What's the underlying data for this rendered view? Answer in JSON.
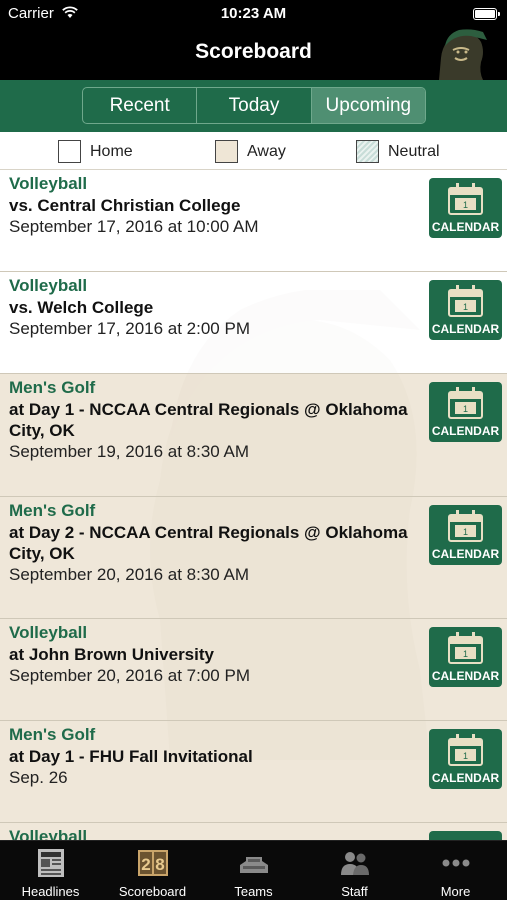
{
  "status_bar": {
    "carrier": "Carrier",
    "time": "10:23 AM"
  },
  "nav": {
    "title": "Scoreboard"
  },
  "segments": [
    {
      "label": "Recent",
      "active": false
    },
    {
      "label": "Today",
      "active": false
    },
    {
      "label": "Upcoming",
      "active": true
    }
  ],
  "legend": {
    "home": "Home",
    "away": "Away",
    "neutral": "Neutral"
  },
  "calendar_label": "CALENDAR",
  "calendar_day": "1",
  "events": [
    {
      "sport": "Volleyball",
      "opponent": "vs. Central Christian College",
      "date": "September 17, 2016 at 10:00 AM",
      "location": "home"
    },
    {
      "sport": "Volleyball",
      "opponent": "vs. Welch College",
      "date": "September 17, 2016 at 2:00 PM",
      "location": "home"
    },
    {
      "sport": "Men's Golf",
      "opponent": "at Day 1 - NCCAA Central Regionals @ Oklahoma City, OK",
      "date": "September 19, 2016 at 8:30 AM",
      "location": "away"
    },
    {
      "sport": "Men's Golf",
      "opponent": "at Day 2 - NCCAA Central Regionals @ Oklahoma City, OK",
      "date": "September 20, 2016 at 8:30 AM",
      "location": "away"
    },
    {
      "sport": "Volleyball",
      "opponent": "at John Brown University",
      "date": "September 20, 2016 at 7:00 PM",
      "location": "away"
    },
    {
      "sport": "Men's Golf",
      "opponent": "at Day 1 - FHU Fall Invitational",
      "date": "Sep. 26",
      "location": "away"
    },
    {
      "sport": "Volleyball",
      "opponent": "",
      "date": "",
      "location": "away"
    }
  ],
  "tabs": [
    {
      "label": "Headlines",
      "icon": "newspaper-icon"
    },
    {
      "label": "Scoreboard",
      "icon": "scoreboard-icon",
      "active": true
    },
    {
      "label": "Teams",
      "icon": "stadium-icon"
    },
    {
      "label": "Staff",
      "icon": "people-icon"
    },
    {
      "label": "More",
      "icon": "more-dots-icon"
    }
  ],
  "colors": {
    "brand_green": "#1f6b4a",
    "away_bg": "#ece3d2",
    "active_tab": "#c9a46a"
  }
}
